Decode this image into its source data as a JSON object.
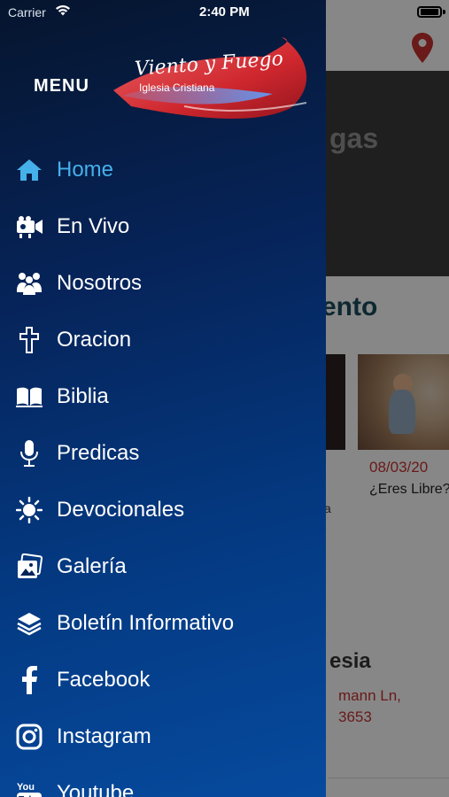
{
  "status_bar": {
    "carrier": "Carrier",
    "time": "2:40 PM"
  },
  "drawer": {
    "menu_title": "MENU",
    "logo": {
      "script": "Viento y Fuego",
      "subtitle": "Iglesia Cristiana"
    },
    "active_color": "#45b0ea",
    "items": [
      {
        "label": "Home",
        "icon": "home-icon",
        "active": true
      },
      {
        "label": "En Vivo",
        "icon": "video-camera-icon",
        "active": false
      },
      {
        "label": "Nosotros",
        "icon": "users-icon",
        "active": false
      },
      {
        "label": "Oracion",
        "icon": "cross-icon",
        "active": false
      },
      {
        "label": "Biblia",
        "icon": "book-icon",
        "active": false
      },
      {
        "label": "Predicas",
        "icon": "microphone-icon",
        "active": false
      },
      {
        "label": "Devocionales",
        "icon": "sun-icon",
        "active": false
      },
      {
        "label": "Galería",
        "icon": "gallery-icon",
        "active": false
      },
      {
        "label": "Boletín Informativo",
        "icon": "layers-icon",
        "active": false
      },
      {
        "label": "Facebook",
        "icon": "facebook-icon",
        "active": false
      },
      {
        "label": "Instagram",
        "icon": "instagram-icon",
        "active": false
      },
      {
        "label": "Youtube",
        "icon": "youtube-icon",
        "active": false
      }
    ]
  },
  "background": {
    "hero_partial_text": "gas",
    "section_partial_title": "ento",
    "post": {
      "date_partial": "08/03/20",
      "title_partial": "¿Eres Libre?"
    },
    "fragment_text": "a",
    "church_partial_title": "esia",
    "address_line1_partial": "mann Ln,",
    "address_line2_partial": "3653"
  }
}
